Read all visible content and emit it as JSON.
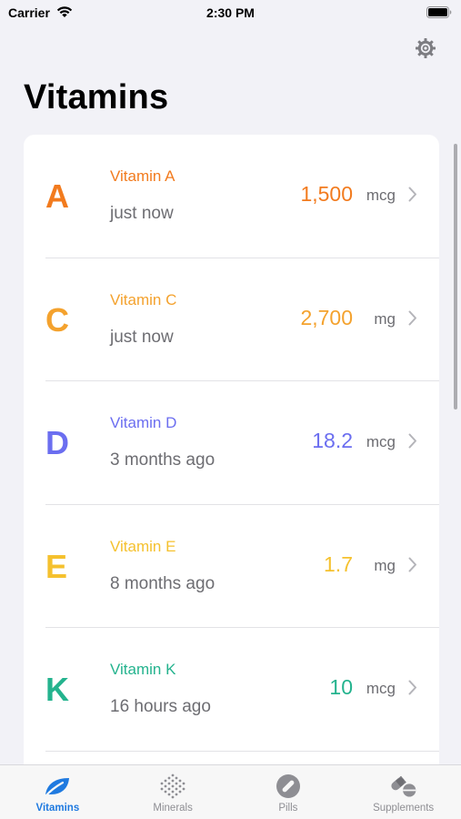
{
  "status_bar": {
    "carrier": "Carrier",
    "time": "2:30 PM"
  },
  "header": {
    "title": "Vitamins",
    "settings_icon": "gear-icon"
  },
  "vitamins": [
    {
      "letter": "A",
      "name": "Vitamin A",
      "time": "just now",
      "amount": "1,500",
      "unit": "mcg",
      "color": "#f27b1e"
    },
    {
      "letter": "C",
      "name": "Vitamin C",
      "time": "just now",
      "amount": "2,700",
      "unit": "mg",
      "color": "#f4a22e"
    },
    {
      "letter": "D",
      "name": "Vitamin D",
      "time": "3 months ago",
      "amount": "18.2",
      "unit": "mcg",
      "color": "#6b6ef0"
    },
    {
      "letter": "E",
      "name": "Vitamin E",
      "time": "8 months ago",
      "amount": "1.7",
      "unit": "mg",
      "color": "#f5c12e"
    },
    {
      "letter": "K",
      "name": "Vitamin K",
      "time": "16 hours ago",
      "amount": "10",
      "unit": "mcg",
      "color": "#24b38e"
    }
  ],
  "tab_bar": {
    "tabs": [
      {
        "label": "Vitamins",
        "icon": "leaf-icon",
        "active": true
      },
      {
        "label": "Minerals",
        "icon": "dots-grid-icon",
        "active": false
      },
      {
        "label": "Pills",
        "icon": "pill-icon",
        "active": false
      },
      {
        "label": "Supplements",
        "icon": "capsules-icon",
        "active": false
      }
    ],
    "active_color": "#1f7ae0",
    "inactive_color": "#8e8e93"
  }
}
